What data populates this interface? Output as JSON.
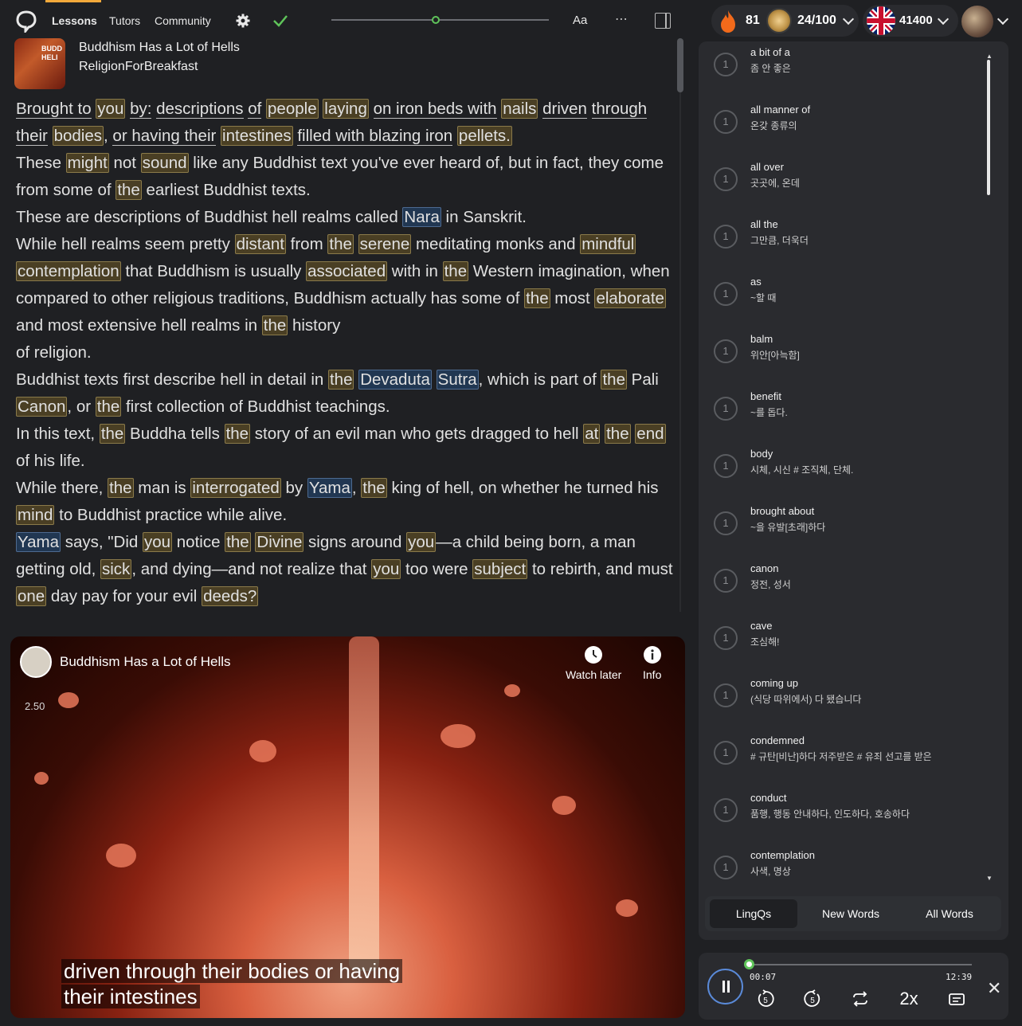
{
  "nav": {
    "lessons": "Lessons",
    "tutors": "Tutors",
    "community": "Community",
    "font_button": "Aa",
    "more": "⋯"
  },
  "lesson": {
    "title": "Buddhism Has a Lot of Hells",
    "channel": "ReligionForBreakfast",
    "thumb_text": "BUDD\nHELI",
    "reading_progress": 0.48
  },
  "stats": {
    "streak": "81",
    "daily_goal": "24/100",
    "known_words": "41400"
  },
  "reader_paragraphs": [
    [
      [
        "Brought to",
        "w"
      ],
      [
        " ",
        "t"
      ],
      [
        "you",
        "k"
      ],
      [
        " ",
        "t"
      ],
      [
        "by:",
        "w"
      ],
      [
        " ",
        "t"
      ],
      [
        "descriptions",
        "w"
      ],
      [
        " ",
        "t"
      ],
      [
        "of",
        "w"
      ],
      [
        " ",
        "t"
      ],
      [
        "people",
        "k"
      ],
      [
        " ",
        "t"
      ],
      [
        "laying",
        "k"
      ],
      [
        " ",
        "t"
      ],
      [
        "on iron beds with",
        "w"
      ],
      [
        " ",
        "t"
      ],
      [
        "nails",
        "k"
      ],
      [
        " ",
        "t"
      ],
      [
        "driven",
        "w"
      ],
      [
        " ",
        "t"
      ],
      [
        "through their",
        "w"
      ],
      [
        " ",
        "t"
      ],
      [
        "bodies",
        "k"
      ],
      [
        ", ",
        "t"
      ],
      [
        "or having their",
        "w"
      ],
      [
        " ",
        "t"
      ],
      [
        "intestines",
        "k"
      ],
      [
        " ",
        "t"
      ],
      [
        "filled with blazing iron",
        "w"
      ],
      [
        " ",
        "t"
      ],
      [
        "pellets.",
        "k"
      ]
    ],
    [
      [
        "These ",
        "t"
      ],
      [
        "might",
        "k"
      ],
      [
        " not ",
        "t"
      ],
      [
        "sound",
        "k"
      ],
      [
        " like any Buddhist text you've ever heard of, but in fact, they come from some of ",
        "t"
      ],
      [
        "the",
        "k"
      ],
      [
        " earliest Buddhist texts.",
        "t"
      ]
    ],
    [
      [
        "These are descriptions of Buddhist hell realms called ",
        "t"
      ],
      [
        "Nara",
        "b"
      ],
      [
        " in Sanskrit.",
        "t"
      ]
    ],
    [
      [
        "While hell realms seem pretty ",
        "t"
      ],
      [
        "distant",
        "k"
      ],
      [
        " from ",
        "t"
      ],
      [
        "the",
        "k"
      ],
      [
        " ",
        "t"
      ],
      [
        "serene",
        "k"
      ],
      [
        " meditating monks and ",
        "t"
      ],
      [
        "mindful",
        "k"
      ],
      [
        " ",
        "t"
      ],
      [
        "contemplation",
        "k"
      ],
      [
        " that Buddhism is usually ",
        "t"
      ],
      [
        "associated",
        "k"
      ],
      [
        " with in ",
        "t"
      ],
      [
        "the",
        "k"
      ],
      [
        " Western imagination, when compared to other religious traditions, Buddhism actually has some of ",
        "t"
      ],
      [
        "the",
        "k"
      ],
      [
        " most ",
        "t"
      ],
      [
        "elaborate",
        "k"
      ],
      [
        " and most extensive hell realms in ",
        "t"
      ],
      [
        "the",
        "k"
      ],
      [
        " history",
        "t"
      ]
    ],
    [
      [
        "of religion.",
        "t"
      ]
    ],
    [
      [
        "Buddhist texts first describe hell in detail in ",
        "t"
      ],
      [
        "the",
        "k"
      ],
      [
        " ",
        "t"
      ],
      [
        "Devaduta",
        "b"
      ],
      [
        " ",
        "t"
      ],
      [
        "Sutra",
        "b"
      ],
      [
        ", which is part of ",
        "t"
      ],
      [
        "the",
        "k"
      ],
      [
        " Pali ",
        "t"
      ],
      [
        "Canon",
        "k"
      ],
      [
        ", or ",
        "t"
      ],
      [
        "the",
        "k"
      ],
      [
        " first collection of Buddhist teachings.",
        "t"
      ]
    ],
    [
      [
        "In this text, ",
        "t"
      ],
      [
        "the",
        "k"
      ],
      [
        " Buddha tells ",
        "t"
      ],
      [
        "the",
        "k"
      ],
      [
        " story of an evil man who gets dragged to hell ",
        "t"
      ],
      [
        "at",
        "k"
      ],
      [
        " ",
        "t"
      ],
      [
        "the",
        "k"
      ],
      [
        " ",
        "t"
      ],
      [
        "end",
        "k"
      ],
      [
        " of his life.",
        "t"
      ]
    ],
    [
      [
        "While there, ",
        "t"
      ],
      [
        "the",
        "k"
      ],
      [
        " man is ",
        "t"
      ],
      [
        "interrogated",
        "k"
      ],
      [
        " by ",
        "t"
      ],
      [
        "Yama",
        "b"
      ],
      [
        ", ",
        "t"
      ],
      [
        "the",
        "k"
      ],
      [
        " king of hell, on whether he turned his ",
        "t"
      ],
      [
        "mind",
        "k"
      ],
      [
        " to Buddhist practice while alive.",
        "t"
      ]
    ],
    [
      [
        "Yama",
        "b"
      ],
      [
        " says, \"Did ",
        "t"
      ],
      [
        "you",
        "k"
      ],
      [
        " notice ",
        "t"
      ],
      [
        "the",
        "k"
      ],
      [
        " ",
        "t"
      ],
      [
        "Divine",
        "k"
      ],
      [
        " signs around ",
        "t"
      ],
      [
        "you",
        "k"
      ],
      [
        "—a child being born, a man getting old, ",
        "t"
      ],
      [
        "sick",
        "k"
      ],
      [
        ", and dying—and not realize that ",
        "t"
      ],
      [
        "you",
        "k"
      ],
      [
        " too were ",
        "t"
      ],
      [
        "subject",
        "k"
      ],
      [
        " to rebirth, and must ",
        "t"
      ],
      [
        "one",
        "k"
      ],
      [
        " day pay for your evil ",
        "t"
      ],
      [
        "deeds?",
        "k"
      ]
    ]
  ],
  "video": {
    "title": "Buddhism Has a Lot of Hells",
    "watch_later": "Watch later",
    "info": "Info",
    "speed": "2.50",
    "subtitle_line1": "driven through their bodies or having",
    "subtitle_line2": "their intestines"
  },
  "words": [
    {
      "count": "1",
      "term": "a bit of a",
      "def": "좀 안 좋은"
    },
    {
      "count": "1",
      "term": "all manner of",
      "def": "온갖 종류의"
    },
    {
      "count": "1",
      "term": "all over",
      "def": "곳곳에, 온데"
    },
    {
      "count": "1",
      "term": "all the",
      "def": "그만큼, 더욱더"
    },
    {
      "count": "1",
      "term": "as",
      "def": "~할 때"
    },
    {
      "count": "1",
      "term": "balm",
      "def": "위안[아늑함]"
    },
    {
      "count": "1",
      "term": "benefit",
      "def": "~를 돕다."
    },
    {
      "count": "1",
      "term": "body",
      "def": "시체, 시신 # 조직체, 단체."
    },
    {
      "count": "1",
      "term": "brought about",
      "def": "~을 유발[초래]하다"
    },
    {
      "count": "1",
      "term": "canon",
      "def": "정전, 성서"
    },
    {
      "count": "1",
      "term": "cave",
      "def": "조심해!"
    },
    {
      "count": "1",
      "term": "coming up",
      "def": "(식당 따위에서) 다 됐습니다"
    },
    {
      "count": "1",
      "term": "condemned",
      "def": "# 규탄[비난]하다 저주받은 # 유죄 선고를 받은"
    },
    {
      "count": "1",
      "term": "conduct",
      "def": "품행, 행동 안내하다, 인도하다, 호송하다"
    },
    {
      "count": "1",
      "term": "contemplation",
      "def": "사색, 명상"
    }
  ],
  "tabs": {
    "lingqs": "LingQs",
    "new_words": "New Words",
    "all_words": "All Words",
    "active": "LingQs"
  },
  "player": {
    "current_time": "00:07",
    "total_time": "12:39",
    "rewind_label": "5",
    "forward_label": "5",
    "speed_label": "2x",
    "progress": 0.01
  },
  "icons": [
    "lingq-logo-icon",
    "gear-icon",
    "check-icon",
    "sidebar-toggle-icon",
    "flame-icon",
    "coin-icon",
    "uk-flag-icon",
    "chevron-down-icon",
    "clock-icon",
    "info-icon",
    "pause-icon",
    "rewind-5-icon",
    "forward-5-icon",
    "repeat-icon",
    "speed-icon",
    "transcript-icon",
    "close-icon"
  ],
  "colors": {
    "accent_green": "#5fc45a",
    "lingq_highlight": "#4a3f24",
    "new_word_highlight": "#213752",
    "flame": "#f26a1b"
  }
}
